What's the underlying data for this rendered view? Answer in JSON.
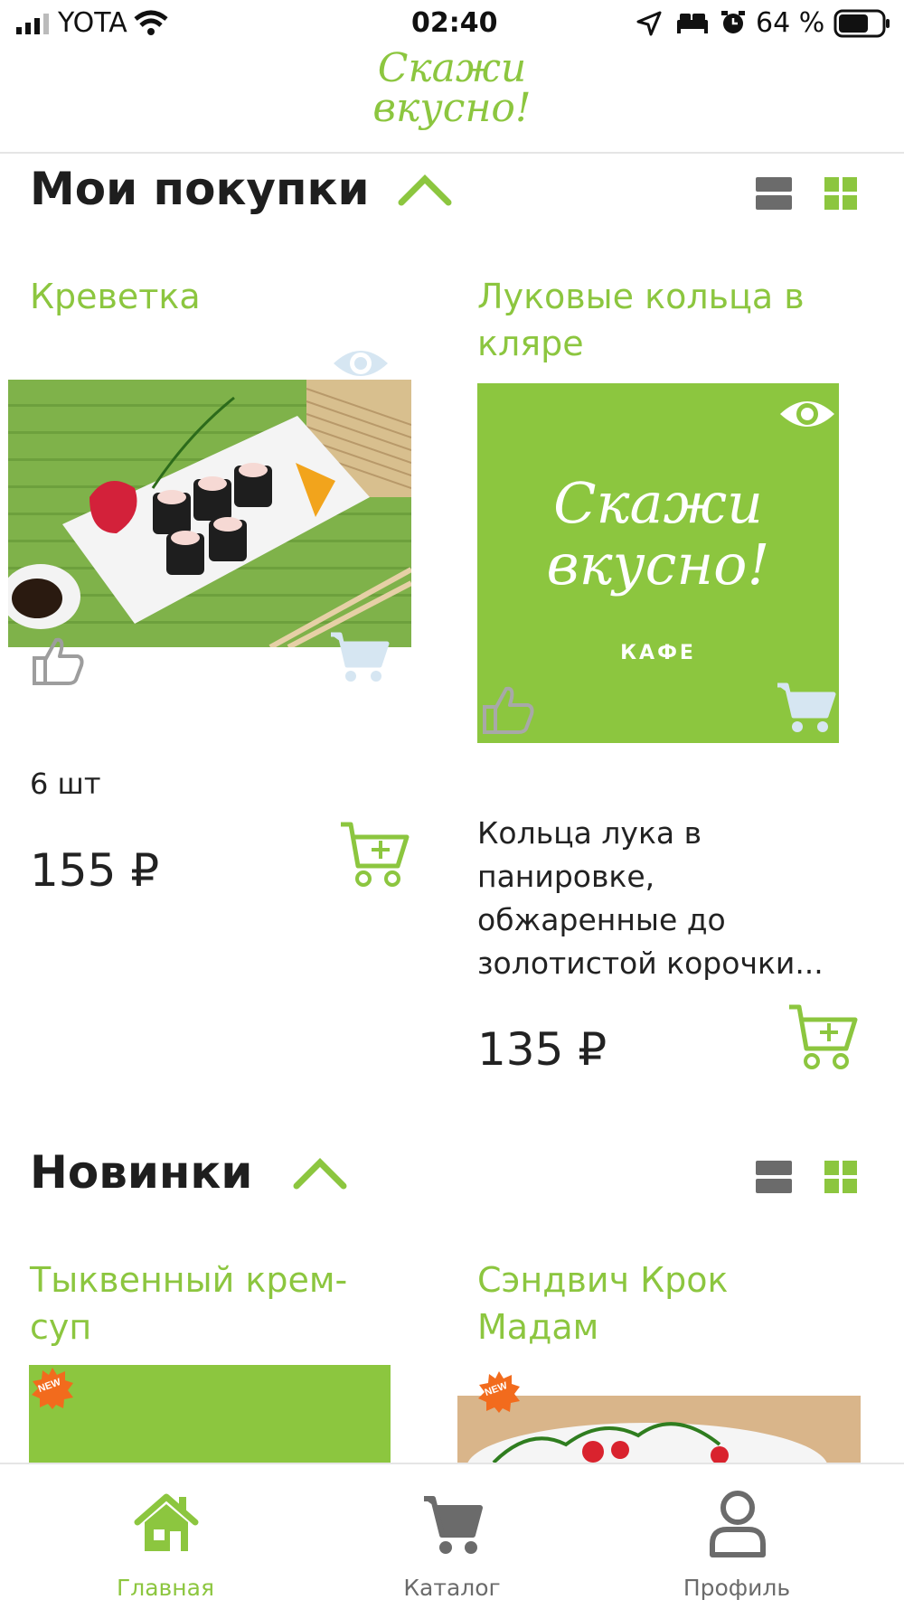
{
  "status_bar": {
    "carrier": "YOTA",
    "time": "02:40",
    "battery": "64 %"
  },
  "header": {
    "logo_line1": "Скажи",
    "logo_line2": "вкусно!"
  },
  "sections": [
    {
      "title": "Мои покупки",
      "products": [
        {
          "title": "Креветка",
          "quantity": "6 шт",
          "price": "155 ₽"
        },
        {
          "title_line1": "Луковые кольца в",
          "title_line2": "кляре",
          "placeholder_logo_line1": "Скажи",
          "placeholder_logo_line2": "вкусно!",
          "placeholder_sub": "КАФЕ",
          "description": [
            "Кольца лука в",
            "панировке,",
            "обжаренные до",
            "золотистой корочки..."
          ],
          "price": "135 ₽"
        }
      ]
    },
    {
      "title": "Новинки",
      "products": [
        {
          "title_line1": "Тыквенный крем-",
          "title_line2": "суп",
          "badge": "NEW"
        },
        {
          "title_line1": "Сэндвич Крок",
          "title_line2": "Мадам",
          "badge": "NEW"
        }
      ]
    }
  ],
  "tabbar": {
    "items": [
      {
        "label": "Главная",
        "icon": "home-icon",
        "active": true
      },
      {
        "label": "Каталог",
        "icon": "cart-icon",
        "active": false
      },
      {
        "label": "Профиль",
        "icon": "profile-icon",
        "active": false
      }
    ]
  },
  "colors": {
    "accent": "#8cc63f",
    "text": "#222222",
    "inactive": "#6b6b6b",
    "cart_light": "#d6e6f2"
  }
}
